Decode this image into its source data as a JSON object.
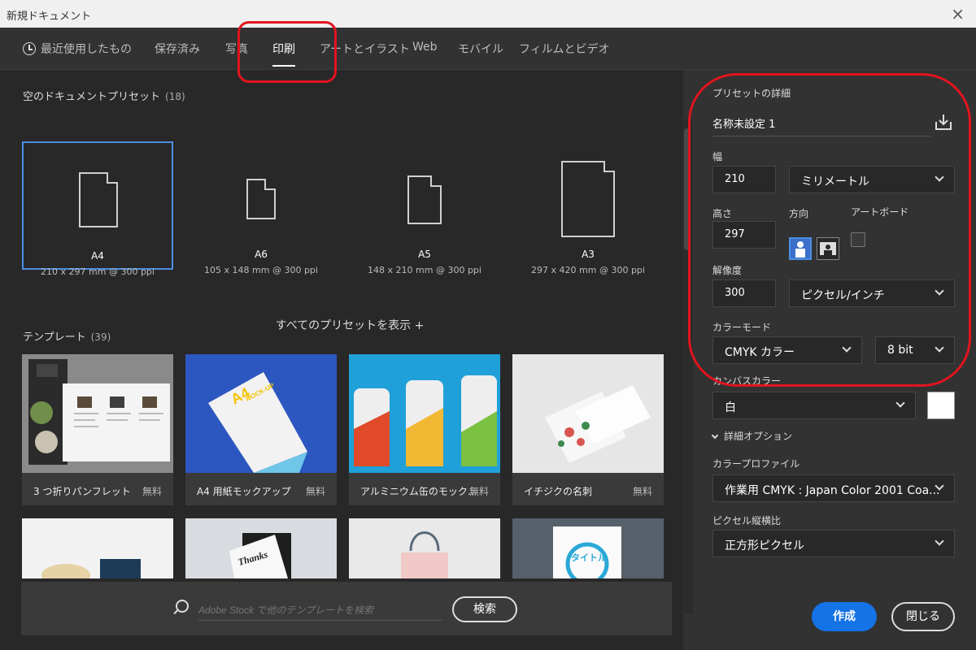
{
  "window": {
    "title": "新規ドキュメント",
    "close_icon": "×"
  },
  "tabs": [
    {
      "label": "最近使用したもの",
      "icon": "clock-icon"
    },
    {
      "label": "保存済み"
    },
    {
      "label": "写真"
    },
    {
      "label": "印刷",
      "active": true
    },
    {
      "label": "アートとイラスト"
    },
    {
      "label": "Web"
    },
    {
      "label": "モバイル"
    },
    {
      "label": "フィルムとビデオ"
    }
  ],
  "presets_section": {
    "title": "空のドキュメントプリセット",
    "count": "(18)"
  },
  "presets": [
    {
      "name": "A4",
      "dims": "210 x 297 mm @ 300 ppi",
      "selected": true
    },
    {
      "name": "A6",
      "dims": "105 x 148 mm @ 300 ppi"
    },
    {
      "name": "A5",
      "dims": "148 x 210 mm @ 300 ppi"
    },
    {
      "name": "A3",
      "dims": "297 x 420 mm @ 300 ppi"
    }
  ],
  "show_all": "すべてのプリセットを表示 +",
  "templates_section": {
    "title": "テンプレート",
    "count": "(39)"
  },
  "templates": [
    {
      "name": "3 つ折りパンフレット",
      "price": "無料"
    },
    {
      "name": "A4 用紙モックアップ",
      "price": "無料"
    },
    {
      "name": "アルミニウム缶のモック...",
      "price": "無料"
    },
    {
      "name": "イチジクの名刺",
      "price": "無料"
    }
  ],
  "template_thumbs_row2": [
    "",
    "",
    "",
    ""
  ],
  "mockup_text": {
    "a4_badge": "A4",
    "mock_up": "MOCK-UP",
    "thanks": "Thanks",
    "title_card": "タイトル"
  },
  "search": {
    "placeholder": "Adobe Stock で他のテンプレートを検索",
    "button": "検索"
  },
  "details": {
    "title": "プリセットの詳細",
    "doc_name": "名称未設定 1",
    "width_label": "幅",
    "width_value": "210",
    "width_unit": "ミリメートル",
    "height_label": "高さ",
    "height_value": "297",
    "orientation_label": "方向",
    "artboard_label": "アートボード",
    "resolution_label": "解像度",
    "resolution_value": "300",
    "resolution_unit": "ピクセル/インチ",
    "color_mode_label": "カラーモード",
    "color_mode": "CMYK カラー",
    "bit_depth": "8 bit",
    "canvas_color_label": "カンバスカラー",
    "canvas_color": "白",
    "advanced_options": "詳細オプション",
    "color_profile_label": "カラープロファイル",
    "color_profile": "作業用 CMYK : Japan Color 2001 Coa...",
    "pixel_aspect_label": "ピクセル縦横比",
    "pixel_aspect": "正方形ピクセル"
  },
  "buttons": {
    "create": "作成",
    "close": "閉じる"
  },
  "colors": {
    "accent": "#1473e6",
    "selection": "#4a8fe2",
    "annotation": "#e0141e"
  }
}
